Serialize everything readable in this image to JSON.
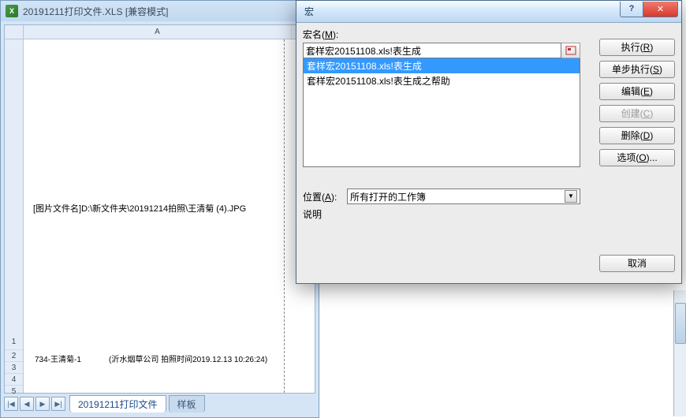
{
  "excel": {
    "title": "20191211打印文件.XLS  [兼容模式]",
    "icon_letter": "X",
    "cell_image_label": "[图片文件名]D:\\新文件夹\\20191214拍照\\王清菊 (4).JPG",
    "row2_left": "734-王清菊-1",
    "row2_right": "(沂水烟草公司 拍照时间2019.12.13 10:26:24)",
    "row_labels": [
      "1",
      "2",
      "3",
      "4",
      "5"
    ],
    "col_a": "A",
    "sheet_tabs": [
      {
        "label": "20191211打印文件",
        "active": true
      },
      {
        "label": "样板",
        "active": false
      }
    ],
    "nav": [
      "|◀",
      "◀",
      "▶",
      "▶|"
    ]
  },
  "dialog": {
    "title": "宏",
    "help": "?",
    "close": "✕",
    "name_label": "宏名(M):",
    "name_value": "套样宏20151108.xls!表生成",
    "list": [
      "套样宏20151108.xls!表生成",
      "套样宏20151108.xls!表生成之帮助"
    ],
    "selected_index": 0,
    "buttons": {
      "run": "执行(R)",
      "step": "单步执行(S)",
      "edit": "编辑(E)",
      "create": "创建(C)",
      "del": "删除(D)",
      "options": "选项(O)..."
    },
    "location_label": "位置(A):",
    "location_value": "所有打开的工作簿",
    "desc_label": "说明",
    "cancel": "取消"
  }
}
